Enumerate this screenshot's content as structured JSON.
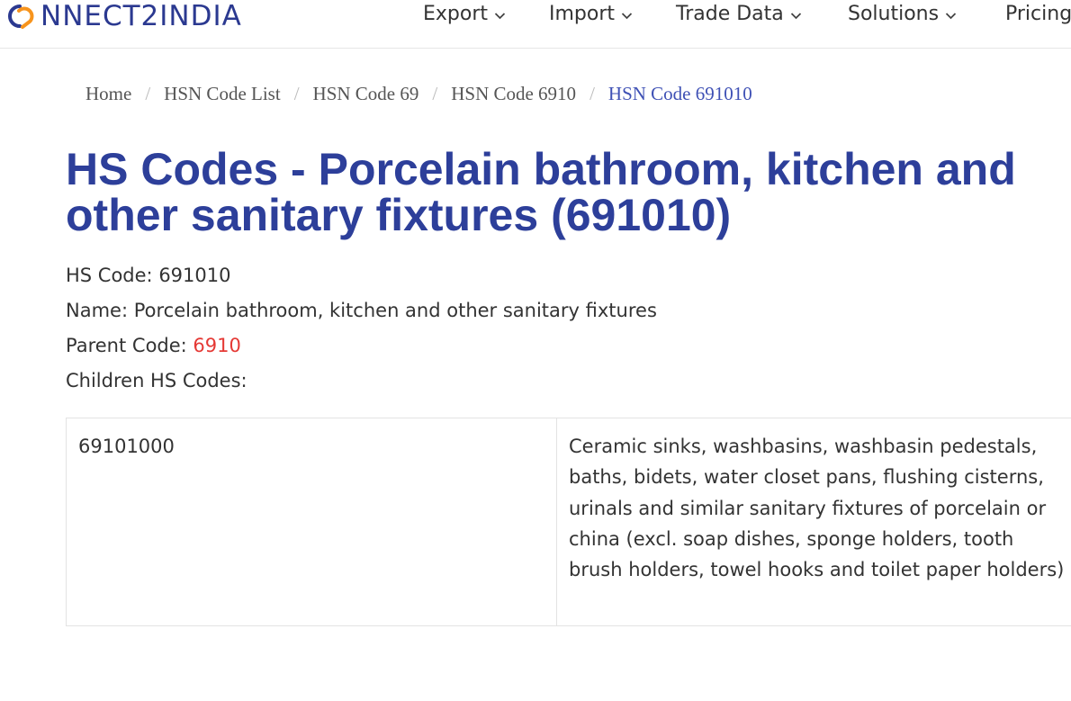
{
  "header": {
    "logo_text": "NNECT2INDIA",
    "nav": [
      {
        "label": "Export"
      },
      {
        "label": "Import"
      },
      {
        "label": "Trade Data"
      },
      {
        "label": "Solutions"
      },
      {
        "label": "Pricing"
      }
    ]
  },
  "breadcrumb": {
    "items": [
      "Home",
      "HSN Code List",
      "HSN Code 69",
      "HSN Code 6910"
    ],
    "active": "HSN Code 691010",
    "separator": "/"
  },
  "page": {
    "title": "HS Codes - Porcelain bathroom, kitchen and other sanitary fixtures (691010)",
    "hs_code_label": "HS Code: ",
    "hs_code_value": "691010",
    "name_label": "Name: ",
    "name_value": "Porcelain bathroom, kitchen and other sanitary fixtures",
    "parent_label": "Parent Code: ",
    "parent_value": "6910",
    "children_label": "Children HS Codes:"
  },
  "children_table": {
    "rows": [
      {
        "code": "69101000",
        "description": "Ceramic sinks, washbasins, washbasin pedestals, baths, bidets, water closet pans, flushing cisterns, urinals and similar sanitary fixtures of porcelain or china (excl. soap dishes, sponge holders, tooth brush holders, towel hooks and toilet paper holders)"
      }
    ]
  },
  "colors": {
    "brand_blue": "#2b3990",
    "title_blue": "#2d3f9a",
    "active_link": "#3f51b5",
    "parent_link": "#e53935",
    "logo_orange": "#f7941d"
  },
  "icons": {
    "logo_mark": "interlocking-rings-icon",
    "nav_dropdown": "chevron-down-icon"
  }
}
